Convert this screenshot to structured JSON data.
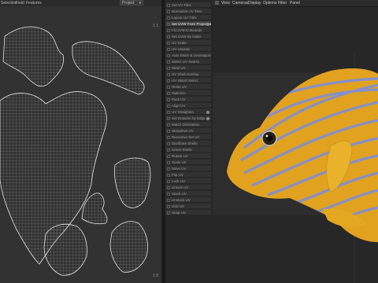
{
  "uv_editor": {
    "menus": [
      "Selection",
      "Field",
      "Features"
    ],
    "project_select": "Project",
    "corner_top": "1 1",
    "corner_bottom": "1 0"
  },
  "commands": [
    {
      "label": "Set UV Tiles",
      "highlighted": false,
      "dot": false
    },
    {
      "label": "Normalize UV Tiles",
      "highlighted": false,
      "dot": false
    },
    {
      "label": "Layout UV Tiles",
      "highlighted": false,
      "dot": false
    },
    {
      "label": "Set UVW From Projection",
      "highlighted": true,
      "dot": true
    },
    {
      "label": "Fit UVW to Bounds",
      "highlighted": false,
      "dot": false
    },
    {
      "label": "Set UVW By Index",
      "highlighted": false,
      "dot": false
    },
    {
      "label": "UV Scale",
      "highlighted": false,
      "dot": false
    },
    {
      "label": "UV Unwrap",
      "highlighted": false,
      "dot": false
    },
    {
      "label": "Auto Seam & Unwrapping",
      "highlighted": false,
      "dot": false
    },
    {
      "label": "Select UV Seams",
      "highlighted": false,
      "dot": false
    },
    {
      "label": "Weld UV",
      "highlighted": false,
      "dot": false
    },
    {
      "label": "UV Shell Overlap",
      "highlighted": false,
      "dot": false
    },
    {
      "label": "UV Island Select",
      "highlighted": false,
      "dot": false
    },
    {
      "label": "Relax UV",
      "highlighted": false,
      "dot": false
    },
    {
      "label": "Optimize",
      "highlighted": false,
      "dot": false
    },
    {
      "label": "Pack UV",
      "highlighted": false,
      "dot": false
    },
    {
      "label": "Align UV",
      "highlighted": false,
      "dot": false
    },
    {
      "label": "UV Straighten",
      "highlighted": false,
      "dot": true
    },
    {
      "label": "Set Rotation by Edge",
      "highlighted": false,
      "dot": true
    },
    {
      "label": "Match Orientation",
      "highlighted": false,
      "dot": false
    },
    {
      "label": "Straighten UV",
      "highlighted": false,
      "dot": false
    },
    {
      "label": "Recursive Set UV",
      "highlighted": false,
      "dot": false
    },
    {
      "label": "Distribute Shells",
      "highlighted": false,
      "dot": false
    },
    {
      "label": "Orient Shells",
      "highlighted": false,
      "dot": false
    },
    {
      "label": "Rotate UV",
      "highlighted": false,
      "dot": false
    },
    {
      "label": "Scale UV",
      "highlighted": false,
      "dot": false
    },
    {
      "label": "Move UV",
      "highlighted": false,
      "dot": false
    },
    {
      "label": "Flip UV",
      "highlighted": false,
      "dot": false
    },
    {
      "label": "Lock UV",
      "highlighted": false,
      "dot": false
    },
    {
      "label": "Unlock UV",
      "highlighted": false,
      "dot": false
    },
    {
      "label": "Stack UV",
      "highlighted": false,
      "dot": false
    },
    {
      "label": "Unstack UV",
      "highlighted": false,
      "dot": false
    },
    {
      "label": "Grid UV",
      "highlighted": false,
      "dot": false
    },
    {
      "label": "Snap UV",
      "highlighted": false,
      "dot": false
    }
  ],
  "viewport": {
    "menus": [
      "View",
      "Cameras",
      "Display",
      "Options",
      "Filter",
      "Panel"
    ]
  },
  "colors": {
    "fish_body": "#e0a21f",
    "fish_stripe": "#7f8fd6",
    "uv_wire": "#cfcfcf",
    "highlight": "#3e3e3e"
  }
}
